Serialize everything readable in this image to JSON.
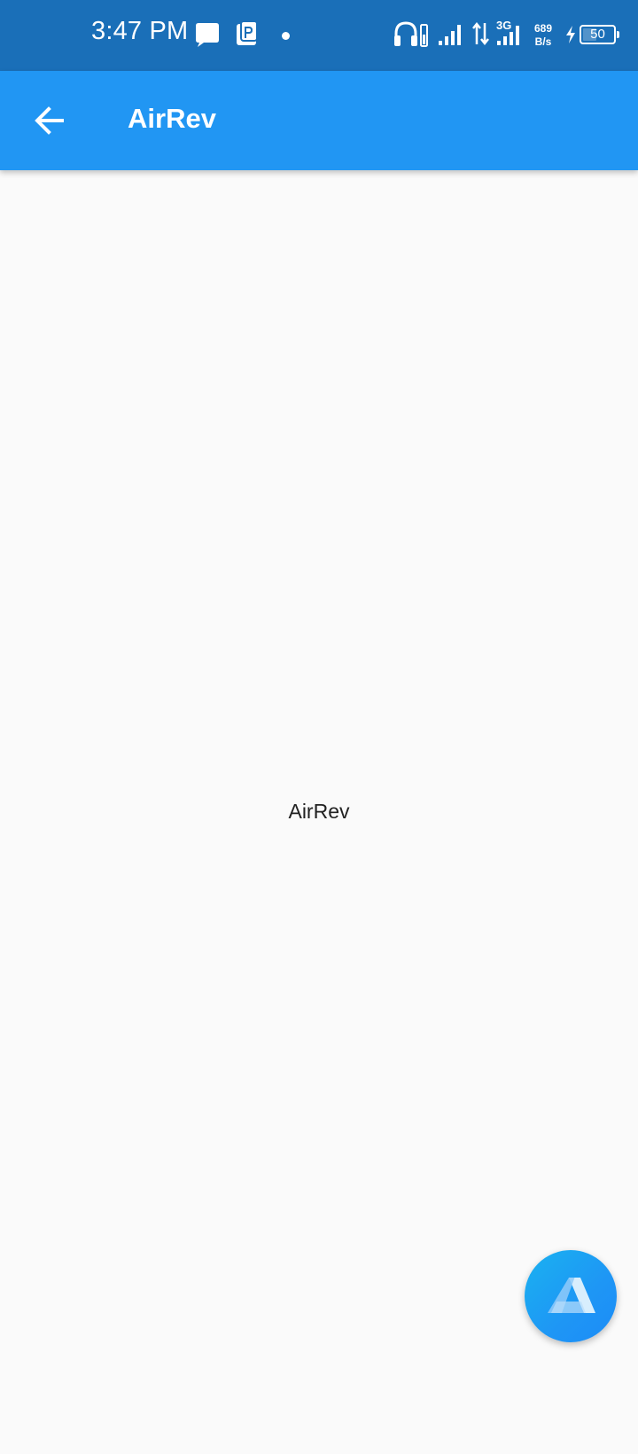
{
  "status_bar": {
    "time": "3:47 PM",
    "network_type": "3G",
    "speed_value": "689",
    "speed_unit": "B/s",
    "battery": "50",
    "battery_fraction": 0.5,
    "icons": [
      "message-icon",
      "pd-app-icon",
      "notification-dot",
      "headphones-icon",
      "signal-icon",
      "data-transfer-icon",
      "signal-3g-icon",
      "charging-bolt-icon",
      "battery-icon"
    ]
  },
  "app_bar": {
    "title": "AirRev",
    "back_icon": "arrow-back-icon",
    "background": "#2196f3"
  },
  "main": {
    "text": "AirRev"
  },
  "fab": {
    "icon": "airrev-logo-icon"
  },
  "colors": {
    "status_bar": "#1a6fb8",
    "app_bar": "#2196f3",
    "background": "#fafafa"
  }
}
